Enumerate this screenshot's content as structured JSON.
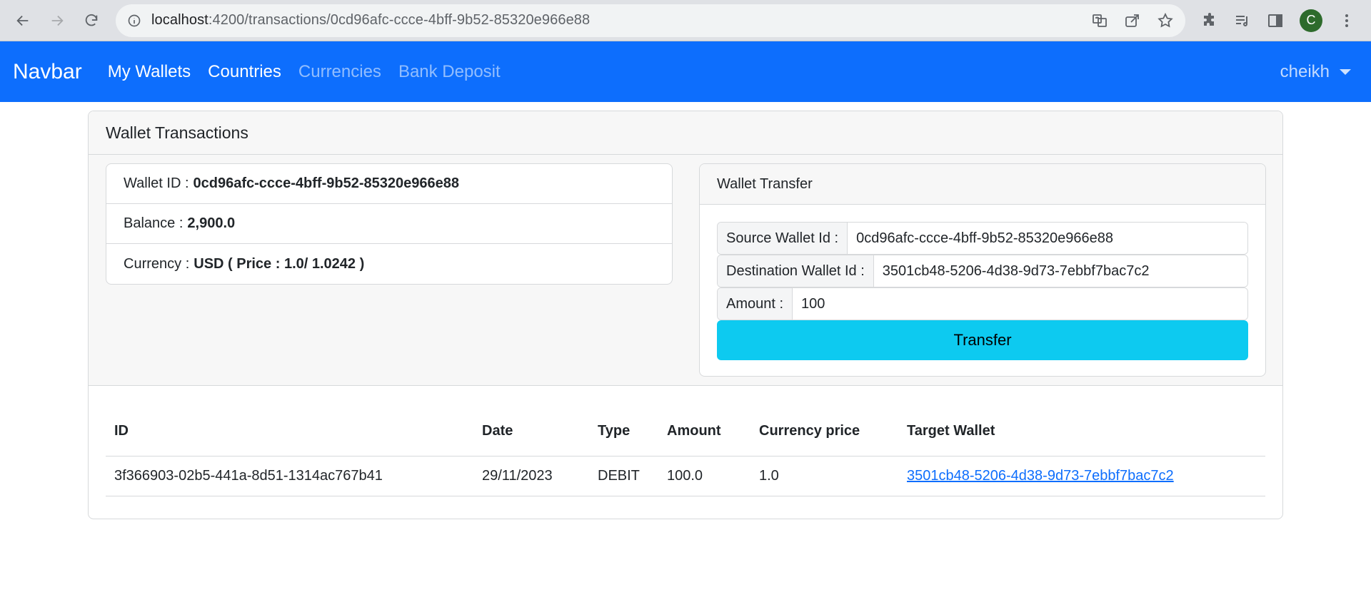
{
  "browser": {
    "url_host": "localhost",
    "url_path": ":4200/transactions/0cd96afc-ccce-4bff-9b52-85320e966e88",
    "profile_initial": "C"
  },
  "navbar": {
    "brand": "Navbar",
    "links": [
      {
        "label": "My Wallets"
      },
      {
        "label": "Countries"
      },
      {
        "label": "Currencies"
      },
      {
        "label": "Bank Deposit"
      }
    ],
    "user": "cheikh"
  },
  "card": {
    "title": "Wallet Transactions"
  },
  "wallet_info": {
    "id_label": "Wallet ID :",
    "id_value": "0cd96afc-ccce-4bff-9b52-85320e966e88",
    "balance_label": "Balance :",
    "balance_value": "2,900.0",
    "currency_label": "Currency :",
    "currency_value": "USD ( Price : 1.0/ 1.0242 )"
  },
  "transfer": {
    "title": "Wallet Transfer",
    "source_label": "Source Wallet Id :",
    "source_value": "0cd96afc-ccce-4bff-9b52-85320e966e88",
    "dest_label": "Destination Wallet Id :",
    "dest_value": "3501cb48-5206-4d38-9d73-7ebbf7bac7c2",
    "amount_label": "Amount :",
    "amount_value": "100",
    "button": "Transfer"
  },
  "table": {
    "headers": [
      "ID",
      "Date",
      "Type",
      "Amount",
      "Currency price",
      "Target Wallet"
    ],
    "rows": [
      [
        "3f366903-02b5-441a-8d51-1314ac767b41",
        "29/11/2023",
        "DEBIT",
        "100.0",
        "1.0",
        "3501cb48-5206-4d38-9d73-7ebbf7bac7c2"
      ]
    ]
  },
  "colors": {
    "navbar": "#0d6efd",
    "transfer_button": "#0dcaf0",
    "link": "#0d6efd"
  }
}
